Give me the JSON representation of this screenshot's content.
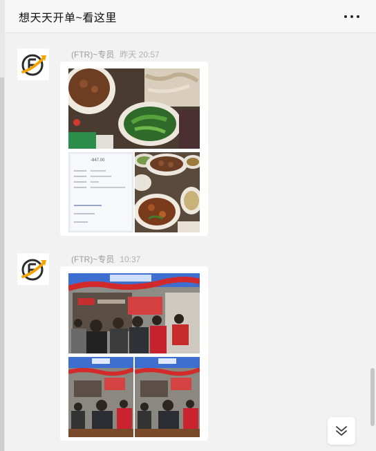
{
  "header": {
    "title": "想天天开单~看这里",
    "more_icon": "more-dots-icon"
  },
  "messages": [
    {
      "sender": "(FTR)~专员",
      "time": "昨天 20:57",
      "avatar_icon": "ftr-logo-icon",
      "images": [
        "food-soup-photo",
        "receipt-screenshot-photo",
        "food-dishes-photo"
      ],
      "receipt": {
        "amount": "-847.00"
      }
    },
    {
      "sender": "(FTR)~专员",
      "time": "10:37",
      "avatar_icon": "ftr-logo-icon",
      "images": [
        "meeting-room-photo",
        "meeting-room-photo-2",
        "meeting-room-photo-3"
      ]
    }
  ],
  "scroll_down_icon": "double-chevron-down-icon",
  "colors": {
    "background": "#f2f2f2",
    "header_bg": "#f7f7f7",
    "logo_orange": "#f5a300",
    "logo_dark": "#2b2b2b"
  }
}
